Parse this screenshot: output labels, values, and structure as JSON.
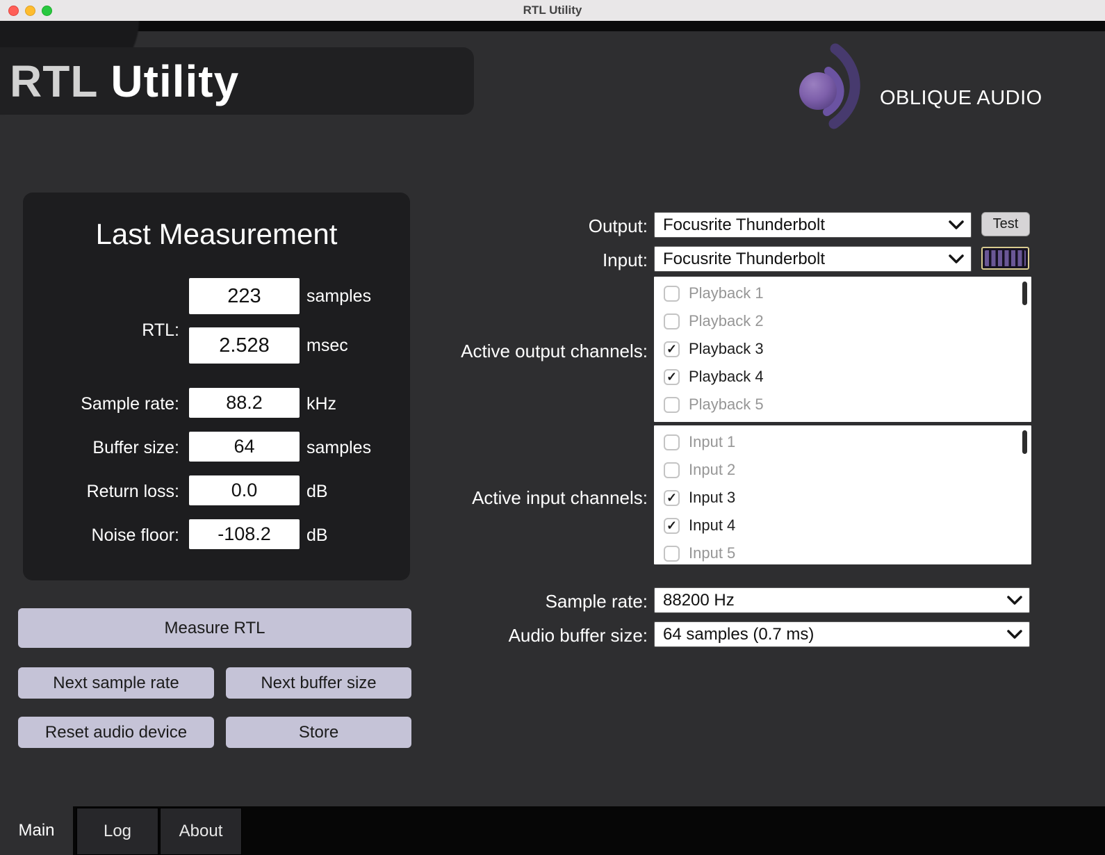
{
  "window": {
    "title": "RTL Utility"
  },
  "header": {
    "app_title_part1": "RTL",
    "app_title_part2": "Utility",
    "brand_name": "OBLIQUE AUDIO"
  },
  "last_measurement": {
    "title": "Last Measurement",
    "rtl": {
      "label": "RTL:",
      "samples_value": "223",
      "samples_unit": "samples",
      "msec_value": "2.528",
      "msec_unit": "msec"
    },
    "rows": [
      {
        "label": "Sample rate:",
        "value": "88.2",
        "unit": "kHz"
      },
      {
        "label": "Buffer size:",
        "value": "64",
        "unit": "samples"
      },
      {
        "label": "Return loss:",
        "value": "0.0",
        "unit": "dB"
      },
      {
        "label": "Noise floor:",
        "value": "-108.2",
        "unit": "dB"
      }
    ]
  },
  "actions": {
    "measure_rtl": "Measure RTL",
    "next_sample_rate": "Next sample rate",
    "next_buffer_size": "Next buffer size",
    "reset_audio_device": "Reset audio device",
    "store": "Store"
  },
  "device_io": {
    "output_label": "Output:",
    "output_device": "Focusrite Thunderbolt",
    "test_button": "Test",
    "input_label": "Input:",
    "input_device": "Focusrite Thunderbolt"
  },
  "output_channels": {
    "label": "Active output channels:",
    "items": [
      {
        "label": "Playback 1",
        "checked": false
      },
      {
        "label": "Playback 2",
        "checked": false
      },
      {
        "label": "Playback 3",
        "checked": true
      },
      {
        "label": "Playback 4",
        "checked": true
      },
      {
        "label": "Playback 5",
        "checked": false
      }
    ]
  },
  "input_channels": {
    "label": "Active input channels:",
    "items": [
      {
        "label": "Input 1",
        "checked": false
      },
      {
        "label": "Input 2",
        "checked": false
      },
      {
        "label": "Input 3",
        "checked": true
      },
      {
        "label": "Input 4",
        "checked": true
      },
      {
        "label": "Input 5",
        "checked": false
      }
    ]
  },
  "audio_settings": {
    "sample_rate_label": "Sample rate:",
    "sample_rate_value": "88200 Hz",
    "buffer_size_label": "Audio buffer size:",
    "buffer_size_value": "64 samples (0.7 ms)"
  },
  "tabs": [
    {
      "label": "Main",
      "active": true
    },
    {
      "label": "Log",
      "active": false
    },
    {
      "label": "About",
      "active": false
    }
  ],
  "colors": {
    "background": "#2e2e30",
    "panel": "#1d1d1f",
    "button": "#c5c3d7",
    "accent_purple": "#7e60ab",
    "meter_border": "#d8cb8f"
  }
}
